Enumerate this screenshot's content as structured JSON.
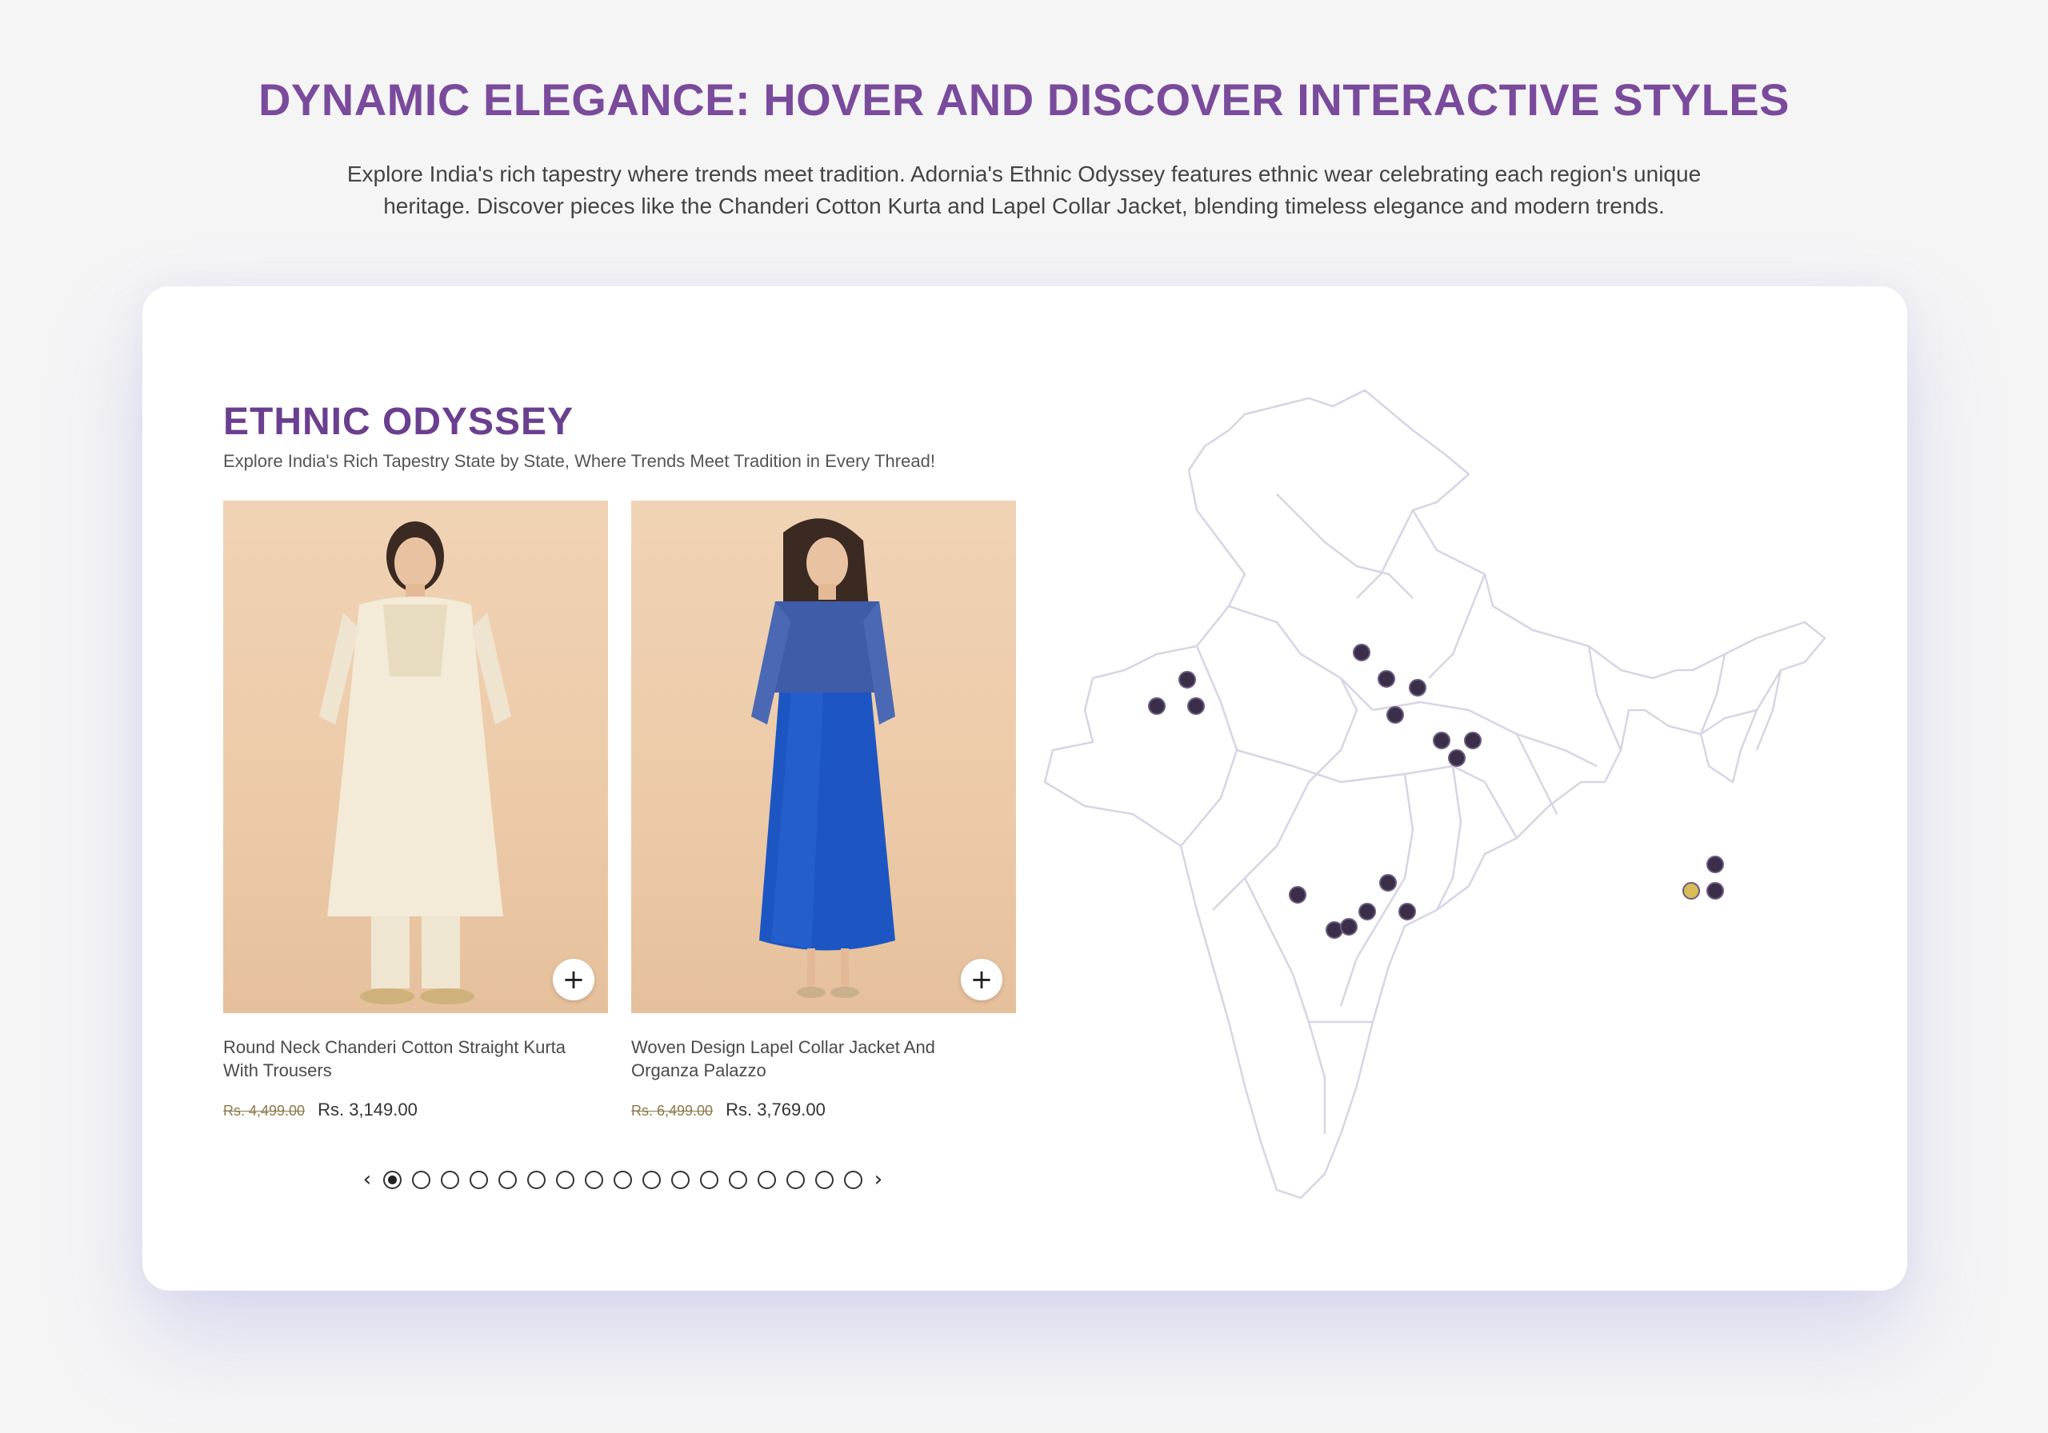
{
  "hero": {
    "title": "DYNAMIC ELEGANCE: HOVER AND DISCOVER INTERACTIVE STYLES",
    "description": "Explore India's rich tapestry where trends meet tradition. Adornia's Ethnic Odyssey features ethnic wear celebrating each region's unique heritage. Discover pieces like the Chanderi Cotton Kurta and Lapel Collar Jacket, blending timeless elegance and modern trends."
  },
  "section": {
    "title": "ETHNIC ODYSSEY",
    "subtitle": "Explore India's Rich Tapestry State by State, Where Trends Meet Tradition in Every Thread!"
  },
  "products": [
    {
      "name": "Round Neck Chanderi Cotton Straight Kurta With Trousers",
      "old_price": "Rs. 4,499.00",
      "price": "Rs. 3,149.00",
      "add_icon": "plus-icon",
      "add_label": "+"
    },
    {
      "name": "Woven Design Lapel Collar Jacket And Organza Palazzo",
      "old_price": "Rs. 6,499.00",
      "price": "Rs. 3,769.00",
      "add_icon": "plus-icon",
      "add_label": "+"
    }
  ],
  "pager": {
    "prev": "‹",
    "next": "›",
    "total_pages": 17,
    "active_page": 1
  },
  "map": {
    "marker_color": "#3a2e48",
    "active_marker_color": "#d9bb57",
    "outline_color": "#d9d4e4",
    "marker_count": 19,
    "active_marker_index": 15
  },
  "colors": {
    "title": "#7a4b9c",
    "section_title": "#6b3f8f",
    "background": "#f5f5f6"
  }
}
